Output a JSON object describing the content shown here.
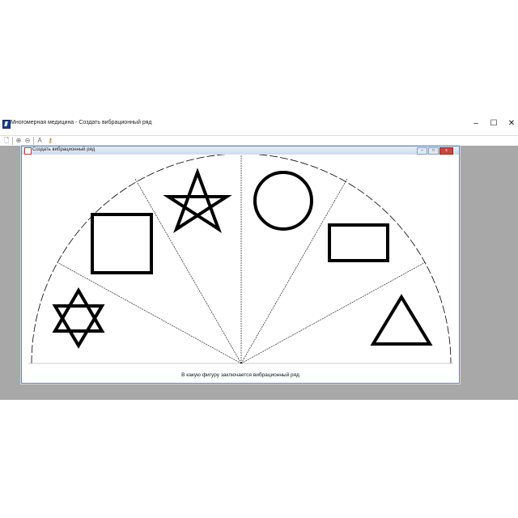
{
  "window": {
    "title": "Многомерная медицина - Создать вибрационный ряд",
    "controls": {
      "minimize": "–",
      "maximize": "☐",
      "close": "✕"
    }
  },
  "toolbar": {
    "buttons": [
      {
        "name": "new-document-icon",
        "glyph": "🗋"
      },
      {
        "name": "zoom-in-icon",
        "glyph": "⊕"
      },
      {
        "name": "zoom-out-icon",
        "glyph": "⊖"
      },
      {
        "name": "text-tool-icon",
        "glyph": "A"
      },
      {
        "name": "key-icon",
        "glyph": "⚷"
      }
    ]
  },
  "child_window": {
    "title": "Создать вибрационный ряд",
    "controls": {
      "minimize": "–",
      "maximize": "□",
      "close": "x"
    }
  },
  "diagram": {
    "sectors": [
      {
        "name": "star-of-david-icon"
      },
      {
        "name": "square-icon"
      },
      {
        "name": "pentagram-icon"
      },
      {
        "name": "circle-icon"
      },
      {
        "name": "rectangle-icon"
      },
      {
        "name": "triangle-icon"
      }
    ]
  },
  "question_text": "В какую фигуру заключается вибрационный ряд"
}
